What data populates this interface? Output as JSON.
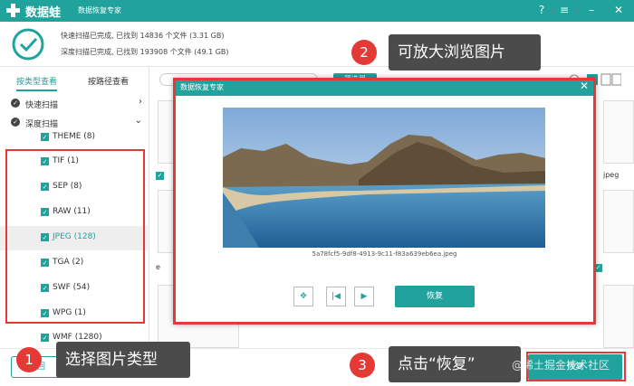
{
  "app": {
    "name": "数据蛙",
    "subtitle": "数据恢复专家"
  },
  "status": {
    "quick_scan": "快速扫描已完成, 已找到 14836 个文件 (3.31 GB)",
    "deep_scan": "深度扫描已完成, 已找到 193908 个文件 (49.1 GB)"
  },
  "sidebar": {
    "tabs": [
      "按类型查看",
      "按路径查看"
    ],
    "tree": [
      {
        "label": "快速扫描"
      },
      {
        "label": "深度扫描"
      }
    ],
    "types": [
      "THEME (8)",
      "TIF (1)",
      "SEP (8)",
      "RAW (11)",
      "JPEG (128)",
      "TGA (2)",
      "SWF (54)",
      "WPG (1)",
      "WMF (1280)"
    ],
    "selected": "JPEG (128)"
  },
  "content": {
    "filter_label": "筛选器",
    "thumb_ext": "jpeg",
    "thumb_prefix": "e"
  },
  "modal": {
    "title": "数据恢复专家",
    "filename": "5a78fcf5-9df8-4913-9c11-f83a639eb6ea.jpeg",
    "recover_label": "恢复"
  },
  "bottom": {
    "back_label": "返回",
    "recover_label": "恢复"
  },
  "callouts": [
    {
      "num": "1",
      "text": "选择图片类型"
    },
    {
      "num": "2",
      "text": "可放大浏览图片"
    },
    {
      "num": "3",
      "text": "点击“恢复”"
    }
  ],
  "watermark": "@稀土掘金技术社区",
  "colors": {
    "accent": "#1fa39c",
    "callout_red": "#e53935",
    "callout_bg": "#4b4b4b"
  }
}
